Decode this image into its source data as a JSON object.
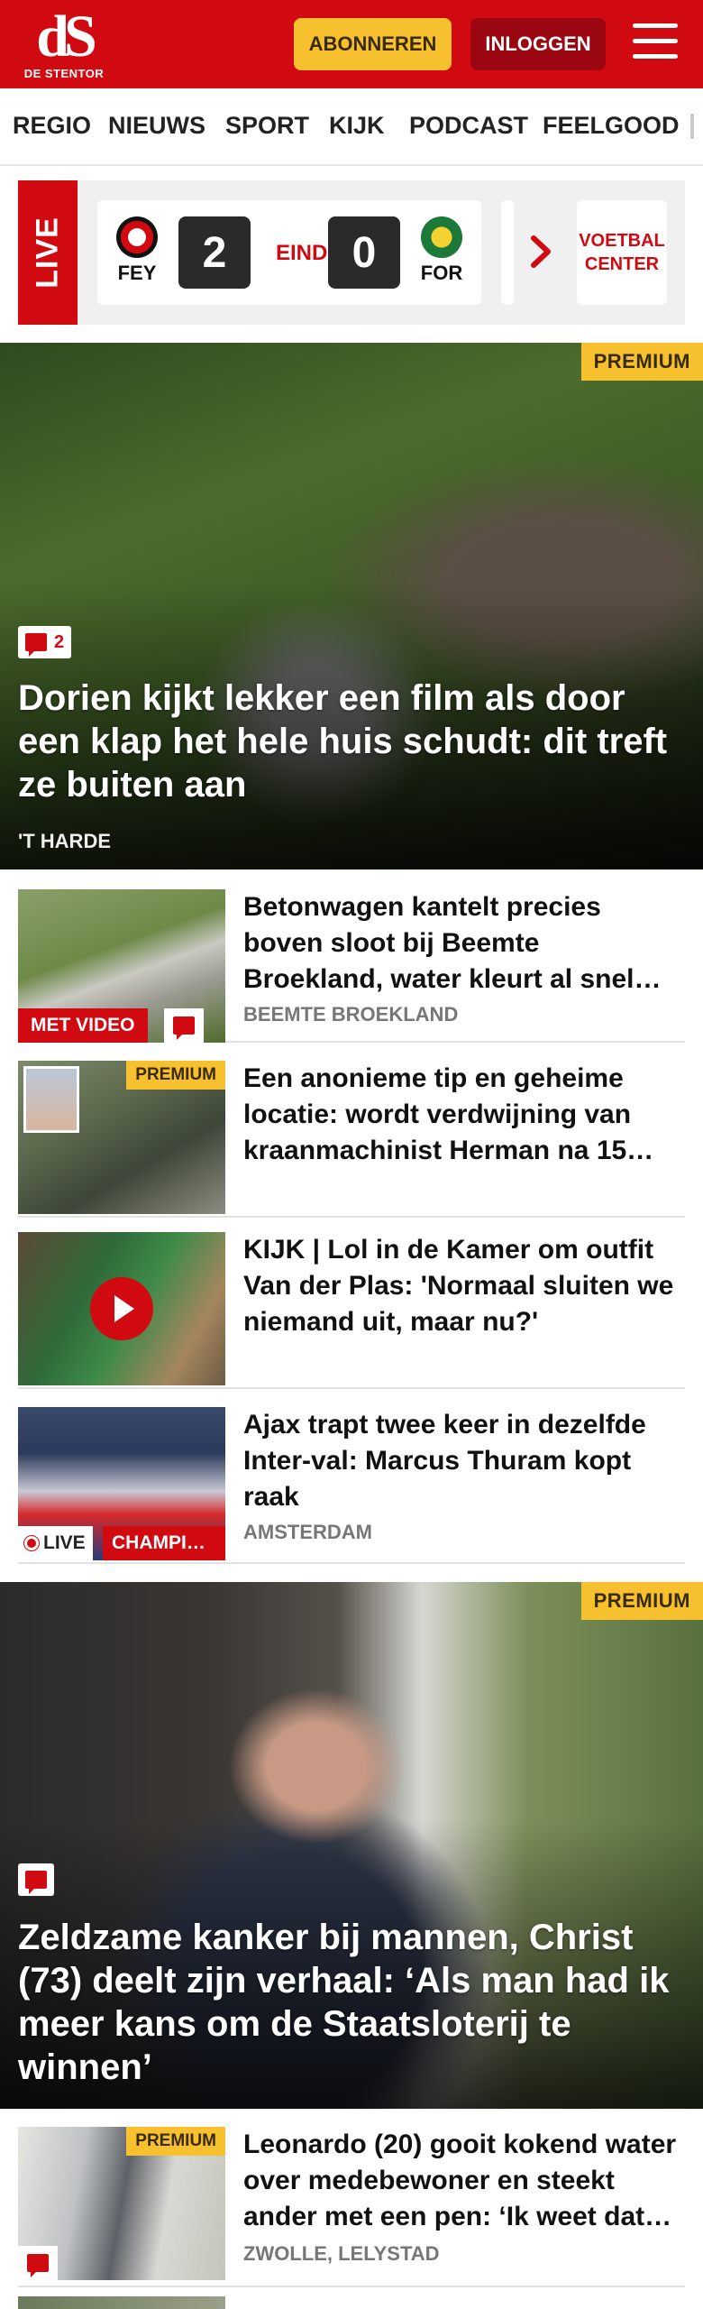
{
  "header": {
    "logo_mark": "dS",
    "logo_text": "DE STENTOR",
    "subscribe_label": "ABONNEREN",
    "login_label": "INLOGGEN",
    "menu_icon": "hamburger-menu-icon",
    "brand_color": "#d10a11",
    "accent_color": "#f6c02e"
  },
  "nav": {
    "items": [
      "REGIO",
      "NIEUWS",
      "SPORT",
      "KIJK",
      "PODCAST",
      "FEELGOOD"
    ]
  },
  "live": {
    "label": "LIVE",
    "match": {
      "home_abbr": "FEY",
      "away_abbr": "FOR",
      "home_score": "2",
      "away_score": "0",
      "status": "EINDE"
    },
    "voetbal_center": "VOETBAL CENTER"
  },
  "articles": {
    "hero1": {
      "premium": "PREMIUM",
      "comments": "2",
      "title": "Dorien kijkt lekker een film als door een klap het hele huis schudt: dit treft ze buiten aan",
      "location": "'T HARDE"
    },
    "list1": [
      {
        "title": "Betonwagen kantelt precies boven sloot bij Beemte Broekland, water kleurt al snel…",
        "location": "BEEMTE BROEKLAND",
        "video_label": "MET VIDEO"
      },
      {
        "title": "Een anonieme tip en geheime locatie: wordt verdwijning van kraanmachinist Herman na 15…",
        "premium": "PREMIUM"
      },
      {
        "title": "KIJK | Lol in de Kamer om outfit Van der Plas: 'Normaal sluiten we niemand uit, maar nu?'"
      },
      {
        "title": "Ajax trapt twee keer in dezelfde Inter-val: Marcus Thuram kopt raak",
        "location": "AMSTERDAM",
        "live_label": "LIVE",
        "tag_label": "CHAMPI…"
      }
    ],
    "hero2": {
      "premium": "PREMIUM",
      "title": "Zeldzame kanker bij mannen, Christ (73) deelt zijn verhaal: ‘Als man had ik meer kans om de Staatsloterij te winnen’"
    },
    "list2": [
      {
        "title": "Leonardo (20) gooit kokend water over medebewoner en steekt ander met een pen: ‘Ik weet dat…",
        "location": "ZWOLLE, LELYSTAD",
        "premium": "PREMIUM"
      }
    ]
  }
}
